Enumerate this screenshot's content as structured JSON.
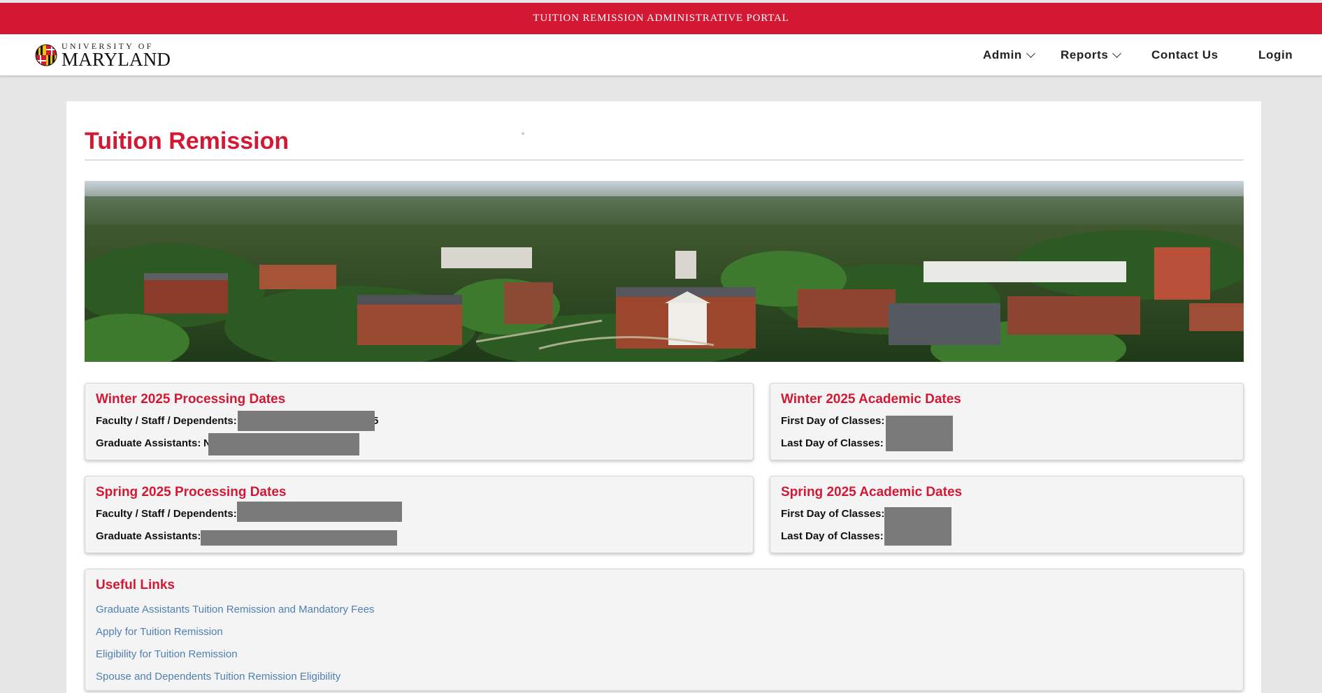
{
  "topbar": {
    "title": "TUITION REMISSION ADMINISTRATIVE PORTAL"
  },
  "logo": {
    "top": "UNIVERSITY OF",
    "bottom": "MARYLAND"
  },
  "nav": {
    "admin": "Admin",
    "reports": "Reports",
    "contact": "Contact Us",
    "login": "Login"
  },
  "page": {
    "title": "Tuition Remission"
  },
  "cards": {
    "winter_processing": {
      "title": "Winter 2025 Processing Dates",
      "row1_label": "Faculty / Staff / Dependents:",
      "row1_stray": "5",
      "row2_label": "Graduate Assistants:",
      "row2_stray": "N"
    },
    "winter_academic": {
      "title": "Winter 2025 Academic Dates",
      "row1_label": "First Day of Classes:",
      "row2_label": "Last Day of Classes:"
    },
    "spring_processing": {
      "title": "Spring 2025 Processing Dates",
      "row1_label": "Faculty / Staff / Dependents:",
      "row2_label": "Graduate Assistants:"
    },
    "spring_academic": {
      "title": "Spring 2025 Academic Dates",
      "row1_label": "First Day of Classes:",
      "row2_label": "Last Day of Classes:"
    }
  },
  "useful_links": {
    "title": "Useful Links",
    "links": [
      "Graduate Assistants Tuition Remission and Mandatory Fees",
      "Apply for Tuition Remission",
      "Eligibility for Tuition Remission",
      "Spouse and Dependents Tuition Remission Eligibility"
    ]
  },
  "colors": {
    "brand_red": "#d31834",
    "link_blue": "#4f7fb4",
    "redaction": "#7a7a7a"
  }
}
